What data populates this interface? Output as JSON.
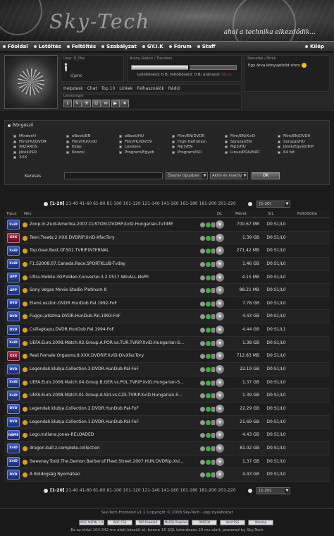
{
  "banner": {
    "logo": "Sky-Tech",
    "slogan": "ahol a technika elkezdődik..."
  },
  "nav": {
    "items": [
      "Főoldal",
      "Letöltés",
      "Feltöltés",
      "Szabályzat",
      "GY.I.K",
      "Fórum",
      "Staff"
    ],
    "logout": "Kilép"
  },
  "user": {
    "name_label": "User: D_Pbe",
    "rank": "Újonc"
  },
  "ratio": {
    "header": "Arány (Ratio) / Transfers",
    "progress": 0.55,
    "stats_prefix": "Letöltéseid: 0 B, feltöltéseid: 0 B, arányod:",
    "ratio_value": "nincs"
  },
  "messages": {
    "header": "Üzenetek / Hírek",
    "text": "Egy árva könyvjelződ sincs"
  },
  "links": [
    "Helpdesk",
    "Chat",
    "Top 10",
    "Linkek",
    "Felhasználók",
    "Rádió"
  ],
  "toolbar": {
    "header": "Lehetőségek",
    "icons": [
      "key-icon",
      "wrench-icon",
      "tools-icon",
      "users-icon",
      "mail-icon",
      "truck-icon",
      "star-icon"
    ]
  },
  "browse": {
    "title": "Böngésző",
    "categories": [
      [
        "Mindent!",
        "eBook/EN",
        "eBook/HU",
        "Film/EN/DVDR",
        "Film/EN/XviD",
        "Film/EN/DVD9"
      ],
      [
        "Film/HU/DVDR",
        "Film/HU/XviD",
        "Film/HU/DVD9",
        "High Definition",
        "Sorozat/EN",
        "Sorozat/HU"
      ],
      [
        "WIZARDS",
        "Klipp",
        "Lossless",
        "Mp3/EN",
        "Mp3/HU",
        "Játék/Egyéb/RIP"
      ],
      [
        "Játék/ISO",
        "Konzol",
        "Program/Egyéb",
        "Program/ISO",
        "Linux/PDA/MAC",
        "64 bit"
      ],
      [
        "XXX"
      ]
    ],
    "search_label": "Keresés",
    "type_select": "Összes típusban",
    "status_select": "Aktív és inaktív",
    "ok_label": "OK"
  },
  "pager": {
    "current": "[1-20]",
    "pages": "21-40 41-60 61-80 81-100 101-120 121-140 141-160 161-180 181-200 201-220",
    "select_value": "[1-20]"
  },
  "table": {
    "headers": {
      "type": "Tipus",
      "name": "Név",
      "dl": "DL",
      "size": "Méret",
      "sl": "S/L",
      "uploader": "Feltöltötte"
    },
    "rows": [
      {
        "type": "XviD",
        "name": "Zoop.in.Zuid-Amerika.2007.CUSTOM.DVDRP.XviD.Hungarian-TvTiME",
        "size": "700.67 MB",
        "sl": "D0:S1/L0"
      },
      {
        "type": "XXX",
        "name": "Teen.Treats.2.XXX.DVDRiP.XviD-XfacTory",
        "size": "1.39 GB",
        "sl": "D0:S1/L0"
      },
      {
        "type": "XviD",
        "name": "Top.Gear.Best.Of.S01.TVRiP.iNTERNAL",
        "size": "271.42 MB",
        "sl": "D0:S1/L0"
      },
      {
        "type": "XviD",
        "name": "F1.S2008.07.Canada.Race.SPORTKLUB-Tvday",
        "size": "1.46 GB",
        "sl": "D0:S1/L0"
      },
      {
        "type": "APP",
        "name": "Ultra.Mobile.3GP.Video.Converter.3.2.0517.WinALL-NoPE",
        "size": "4.15 MB",
        "sl": "D0:S1/L0"
      },
      {
        "type": "APP",
        "name": "Sony Vegas Movie Studio Platinum 8",
        "size": "88.21 MB",
        "sl": "D0:S1/L0"
      },
      {
        "type": "DVD",
        "name": "Elemi.oszton.DVDR.HunDub.Pal.1992-FoF",
        "size": "7.78 GB",
        "sl": "D0:S1/L0"
      },
      {
        "type": "DVD",
        "name": "Fuggo.jatszma.DVDR.HunDub.Pal.1993-FoF",
        "size": "4.43 GB",
        "sl": "D0:S1/L0"
      },
      {
        "type": "DVD",
        "name": "Csillagkapu.DVDR.HunDub.Pal.1994-FoF",
        "size": "4.44 GB",
        "sl": "D0:S1/L1"
      },
      {
        "type": "XviD",
        "name": "UEFA.Euro.2008.Match.02.Group.A.POR.vs.TUR.TVRiP.XviD.Hungarian-S...",
        "size": "1.38 GB",
        "sl": "D0:S1/L0"
      },
      {
        "type": "XXX",
        "name": "Real.Female.Orgasms.8.XXX.DVDRiP.XviD-DivXfacTory",
        "size": "712.83 MB",
        "sl": "D0:S1/L0"
      },
      {
        "type": "DVD",
        "name": "Legendak.klubja.Collection.3.DVDR.HunDub.Pal-FoF",
        "size": "22.19 GB",
        "sl": "D0:S1/L0"
      },
      {
        "type": "XviD",
        "name": "UEFA.Euro.2008.Match.04.Group.B.GER.vs.POL.TVRiP.XviD.Hungarian-S...",
        "size": "1.37 GB",
        "sl": "D0:S1/L0"
      },
      {
        "type": "XviD",
        "name": "UEFA.Euro.2008.Match.01.Group.A.SUI.vs.CZE.TVRiP.XviD.Hungarian-S...",
        "size": "1.39 GB",
        "sl": "D0:S1/L0"
      },
      {
        "type": "DVD",
        "name": "Legendak.klubja.Collection.2.DVDR.HunDub.Pal-FoF",
        "size": "22.29 GB",
        "sl": "D0:S1/L0"
      },
      {
        "type": "DVD",
        "name": "Legendak.klubja.Collection.1.DVDR.HunDub.Pal-FoF",
        "size": "21.69 GB",
        "sl": "D0:S1/L0"
      },
      {
        "type": "GAME",
        "name": "Lego.Indiana.Jones-RELOADED",
        "size": "4.43 GB",
        "sl": "D0:S1/L0"
      },
      {
        "type": "XviD",
        "name": "dragon.ball.z.complete.collection",
        "size": "81.02 GB",
        "sl": "D0:S1/L0"
      },
      {
        "type": "XviD",
        "name": "Sweeney.Todd.The.Demon.Barber.of.Fleet.Street.2007.HUN.DVDRip.Xvi...",
        "size": "1.37 GB",
        "sl": "D0:S1/L0"
      },
      {
        "type": "DVD",
        "name": "A Boldogság Nyomában",
        "size": "4.43 GB",
        "sl": "D0:S1/L0"
      }
    ]
  },
  "footer": {
    "copyright": "Sky-Tech Frontend v1.1 Copyright © 2008 Sky-Tech - Jogi nyilatkozat",
    "badges": [
      "W3C XHTML 1.0",
      "W3C CSS",
      "PHP Powered",
      "MySQL Powered",
      "FIREFOX",
      "Valid RSS",
      "Winamp"
    ],
    "generated": "Ez az oldal 104.342 ms alatt készült el, benne 15 SQL lekérdezés 29 ms alatt, powered by Sky-Tech"
  }
}
